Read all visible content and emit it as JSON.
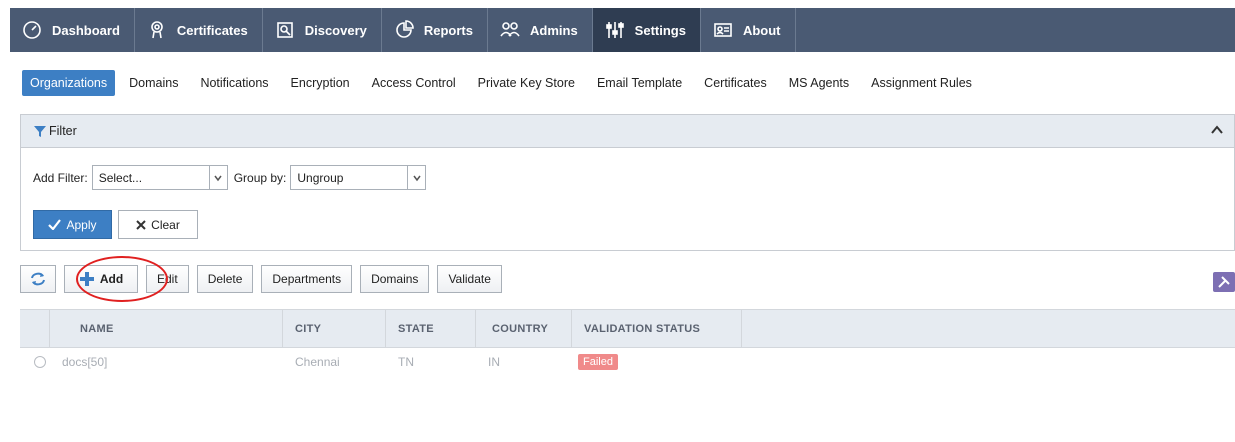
{
  "topnav": {
    "items": [
      {
        "label": "Dashboard",
        "icon": "gauge-icon"
      },
      {
        "label": "Certificates",
        "icon": "certificate-icon"
      },
      {
        "label": "Discovery",
        "icon": "discovery-icon"
      },
      {
        "label": "Reports",
        "icon": "pie-chart-icon"
      },
      {
        "label": "Admins",
        "icon": "admins-icon"
      },
      {
        "label": "Settings",
        "icon": "sliders-icon",
        "active": true
      },
      {
        "label": "About",
        "icon": "id-card-icon"
      }
    ]
  },
  "subtabs": {
    "items": [
      "Organizations",
      "Domains",
      "Notifications",
      "Encryption",
      "Access Control",
      "Private Key Store",
      "Email Template",
      "Certificates",
      "MS Agents",
      "Assignment Rules"
    ],
    "active": "Organizations"
  },
  "filter": {
    "title": "Filter",
    "add_filter_label": "Add Filter:",
    "add_filter_value": "Select...",
    "group_by_label": "Group by:",
    "group_by_value": "Ungroup",
    "apply_label": "Apply",
    "clear_label": "Clear"
  },
  "toolbar": {
    "add_label": "Add",
    "edit_label": "Edit",
    "delete_label": "Delete",
    "departments_label": "Departments",
    "domains_label": "Domains",
    "validate_label": "Validate"
  },
  "grid": {
    "columns": [
      "NAME",
      "CITY",
      "STATE",
      "COUNTRY",
      "VALIDATION STATUS"
    ],
    "rows": [
      {
        "name": "docs[50]",
        "city": "Chennai",
        "state": "TN",
        "country": "IN",
        "validation_status": "Failed"
      }
    ]
  },
  "colors": {
    "nav_bg": "#4a5a73",
    "nav_active": "#2f3d52",
    "accent": "#3d7fc4",
    "failed_badge": "#f08a8a",
    "highlight_circle": "#e02020"
  }
}
